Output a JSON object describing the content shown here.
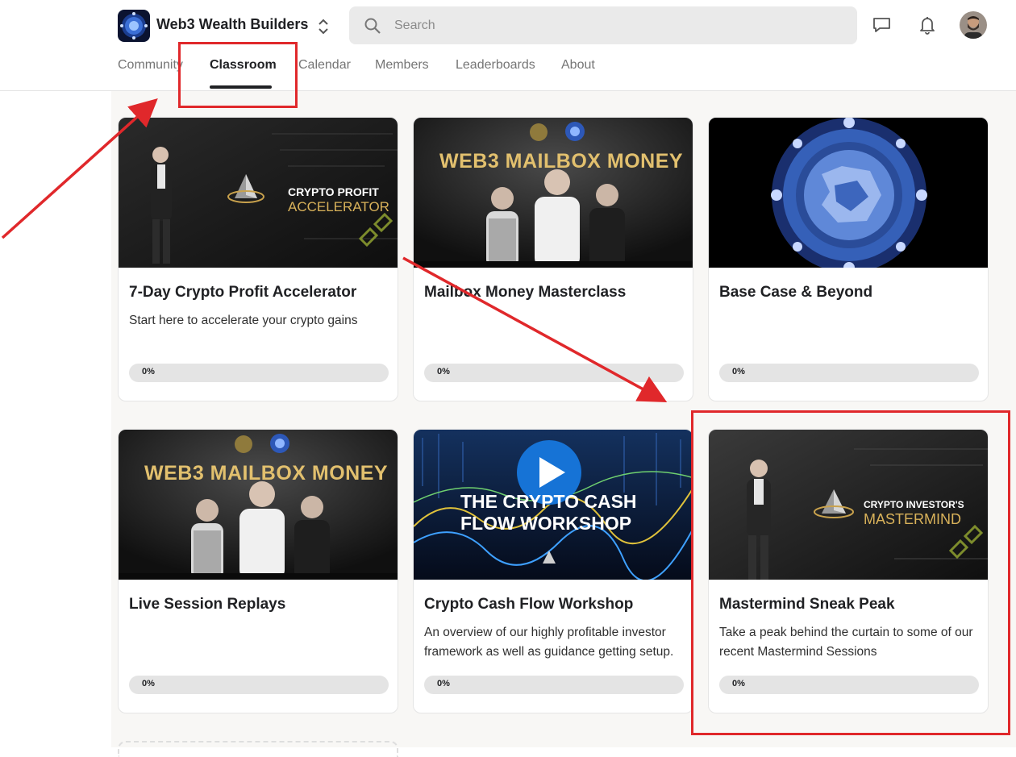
{
  "header": {
    "brand_name": "Web3 Wealth Builders",
    "logo_icon": "community-logo-icon",
    "search_placeholder": "Search",
    "icons": [
      "search-icon",
      "chat-icon",
      "bell-icon",
      "chevron-up-down-icon"
    ]
  },
  "tabs": [
    {
      "label": "Community",
      "active": false
    },
    {
      "label": "Classroom",
      "active": true
    },
    {
      "label": "Calendar",
      "active": false
    },
    {
      "label": "Members",
      "active": false
    },
    {
      "label": "Leaderboards",
      "active": false
    },
    {
      "label": "About",
      "active": false
    }
  ],
  "courses": [
    {
      "title": "7-Day Crypto Profit Accelerator",
      "description": "Start here to accelerate your crypto gains",
      "progress_label": "0%",
      "progress": 0,
      "thumb_line1": "CRYPTO PROFIT",
      "thumb_line2": "ACCELERATOR"
    },
    {
      "title": "Mailbox Money Masterclass",
      "description": "",
      "progress_label": "0%",
      "progress": 0,
      "thumb_line1": "WEB3 MAILBOX MONEY"
    },
    {
      "title": "Base Case & Beyond",
      "description": "",
      "progress_label": "0%",
      "progress": 0
    },
    {
      "title": "Live Session Replays",
      "description": "",
      "progress_label": "0%",
      "progress": 0,
      "thumb_line1": "WEB3 MAILBOX MONEY"
    },
    {
      "title": "Crypto Cash Flow Workshop",
      "description": "An overview of our highly profitable investor framework as well as guidance getting setup.",
      "progress_label": "0%",
      "progress": 0,
      "thumb_line1": "THE CRYPTO CASH",
      "thumb_line2": "FLOW WORKSHOP"
    },
    {
      "title": "Mastermind Sneak Peak",
      "description": "Take a peak behind the curtain to some of our recent Mastermind Sessions",
      "progress_label": "0%",
      "progress": 0,
      "thumb_line1": "CRYPTO INVESTOR'S",
      "thumb_line2": "MASTERMIND"
    }
  ],
  "annotation_color": "#e0282b",
  "accent_gold": "#d9b25a"
}
